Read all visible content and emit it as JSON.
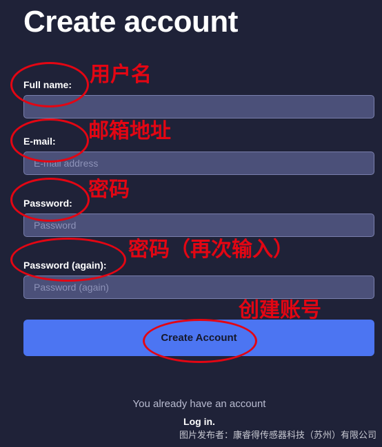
{
  "form": {
    "title": "Create account",
    "fields": [
      {
        "label": "Full name:",
        "placeholder": "",
        "value": ""
      },
      {
        "label": "E-mail:",
        "placeholder": "E-mail address",
        "value": ""
      },
      {
        "label": "Password:",
        "placeholder": "Password",
        "value": ""
      },
      {
        "label": "Password (again):",
        "placeholder": "Password (again)",
        "value": ""
      }
    ],
    "submit_label": "Create Account",
    "login_prompt": "You already have an account",
    "login_link": "Log in."
  },
  "annotations": {
    "full_name": "用户名",
    "email": "邮箱地址",
    "password": "密码",
    "password_again": "密码（再次输入）",
    "create_account": "创建账号"
  },
  "watermark": "图片发布者：康睿得传感器科技（苏州）有限公司",
  "colors": {
    "background": "#1f2238",
    "input_background": "#4b5079",
    "button": "#4c75f2",
    "annotation_red": "#e30613"
  }
}
